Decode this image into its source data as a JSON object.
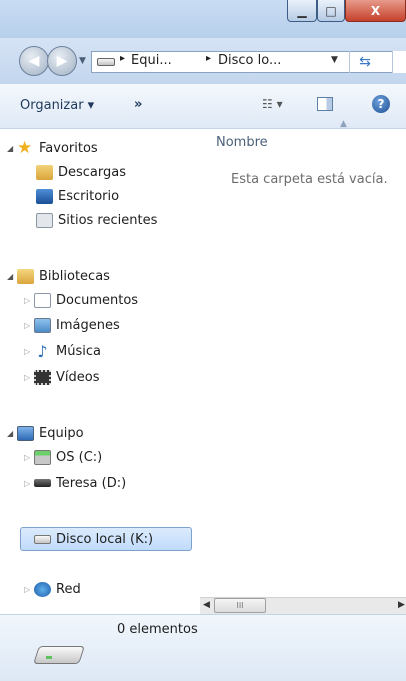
{
  "window": {
    "minimize": "▁",
    "maximize": "□",
    "close": "X"
  },
  "address": {
    "crumbs": [
      "Equi...",
      "Disco lo..."
    ],
    "sep": "▸"
  },
  "toolbar": {
    "organize": "Organizar ▾",
    "more": "»",
    "views": "☷ ▾",
    "help": "?"
  },
  "nav": {
    "favorites": {
      "label": "Favoritos",
      "items": [
        "Descargas",
        "Escritorio",
        "Sitios recientes"
      ]
    },
    "libraries": {
      "label": "Bibliotecas",
      "items": [
        "Documentos",
        "Imágenes",
        "Música",
        "Vídeos"
      ]
    },
    "computer": {
      "label": "Equipo",
      "items": [
        "OS (C:)",
        "Teresa (D:)",
        "Disco local (K:)"
      ]
    },
    "network": {
      "label": "Red"
    }
  },
  "content": {
    "column": "Nombre",
    "empty": "Esta carpeta está vacía."
  },
  "scroll": {
    "thumb": "III"
  },
  "details": {
    "count": "0 elementos"
  },
  "colors": {
    "selected_bg": "#c1dbfc",
    "folder": "#e8c04a",
    "accent": "#3a78c3"
  }
}
